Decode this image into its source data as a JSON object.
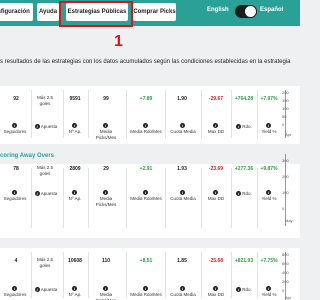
{
  "navbar": {
    "config_label": "nfiguración",
    "ayuda_label": "Ayuda",
    "estrategias_label": "Estrategias Públicas",
    "comprar_label": "Comprar Picks",
    "lang_english": "English",
    "lang_spanish": "Español",
    "toggle_icon": "toggle-switch-icon"
  },
  "annotation": {
    "step_number": "1",
    "color": "#e01414"
  },
  "intro_text": "s resultados de las estrategias con los datos acumulados según las condiciones establecidas en la estrategia",
  "labels": {
    "seguidores": "Seguidores",
    "mas25": "Más 2.5 goles",
    "apuesta": "Apuesta",
    "nap": "Nº Ap.",
    "media_picks": "Media Picks/Mes",
    "media_rdo": "Media Rdo/Mes",
    "cuota_media": "Cuota Media",
    "max_dd": "Max DD",
    "rdo": "Rdo.",
    "yield": "Yield %"
  },
  "cards": [
    {
      "title": "",
      "seguidores": "92",
      "nap": "9591",
      "media_picks": "99",
      "media_rdo": "+7.89",
      "cuota_media": "1.90",
      "max_dd": "-29.67",
      "rdo": "+764.28",
      "yield": "+7.97%",
      "chart_ticks": [
        "200",
        "150",
        "100",
        "50",
        "0"
      ],
      "chart_bottom": "Apr"
    },
    {
      "title": "coring Away Overs",
      "seguidores": "78",
      "nap": "2809",
      "media_picks": "29",
      "media_rdo": "+2.91",
      "cuota_media": "1.93",
      "max_dd": "-23.69",
      "rdo": "+277.36",
      "yield": "+9.87%",
      "chart_ticks": [
        "300",
        "200",
        "100",
        "0"
      ],
      "chart_bottom": "May"
    },
    {
      "title": "",
      "seguidores": "4",
      "nap": "10608",
      "media_picks": "110",
      "media_rdo": "+8.51",
      "cuota_media": "1.85",
      "max_dd": "-25.68",
      "rdo": "+821.93",
      "yield": "+7.75%",
      "chart_ticks": [
        "800",
        "600",
        "400",
        "200",
        "0"
      ],
      "chart_bottom": "Apr"
    }
  ],
  "colors": {
    "navbar": "#2aa197",
    "positive": "#2f9e3f",
    "negative": "#d21f1f",
    "highlight": "#e01414"
  }
}
